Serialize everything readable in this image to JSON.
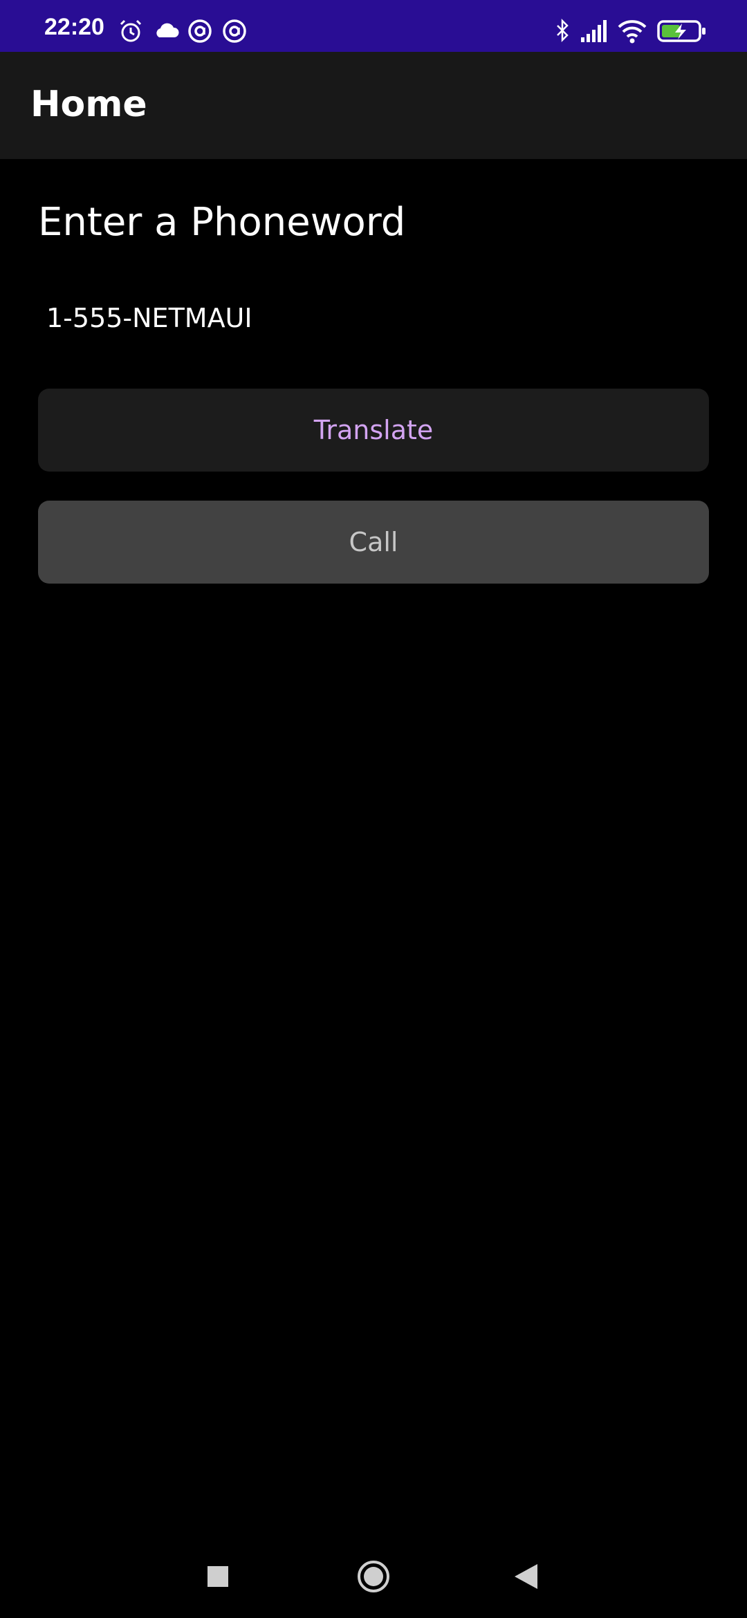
{
  "status_bar": {
    "time": "22:20",
    "background_color": "#290d94",
    "icons_left": [
      "alarm-icon",
      "cloud-icon",
      "at-sign-icon",
      "at-sign-icon"
    ],
    "icons_right": [
      "bluetooth-icon",
      "signal-icon",
      "wifi-icon",
      "battery-charging-icon"
    ]
  },
  "app_bar": {
    "title": "Home"
  },
  "main": {
    "heading": "Enter a Phoneword",
    "phone_entry": {
      "value": "1-555-NETMAUI"
    },
    "translate_button": {
      "label": "Translate",
      "text_color": "#d3a4f2"
    },
    "call_button": {
      "label": "Call",
      "state": "disabled"
    }
  },
  "nav_bar": {
    "buttons": [
      "recents-square-icon",
      "home-circle-icon",
      "back-triangle-icon"
    ]
  }
}
